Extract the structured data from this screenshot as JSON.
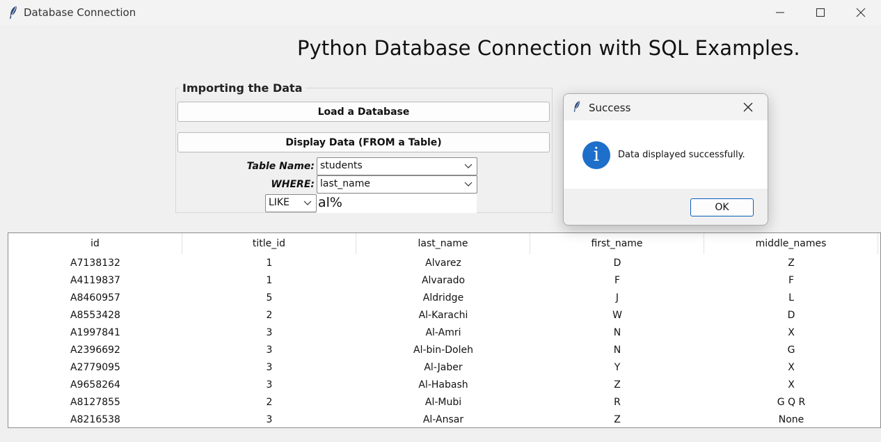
{
  "window": {
    "title": "Database Connection"
  },
  "page": {
    "heading": "Python Database Connection with SQL Examples."
  },
  "import_group": {
    "label": "Importing the Data",
    "load_button": "Load a Database",
    "display_button": "Display Data (FROM a Table)",
    "table_name_label": "Table Name:",
    "table_name_value": "students",
    "where_label": "WHERE:",
    "where_value": "last_name",
    "operator_value": "LIKE",
    "pattern_value": "al%"
  },
  "table": {
    "columns": [
      "id",
      "title_id",
      "last_name",
      "first_name",
      "middle_names"
    ],
    "rows": [
      [
        "A7138132",
        "1",
        "Alvarez",
        "D",
        "Z"
      ],
      [
        "A4119837",
        "1",
        "Alvarado",
        "F",
        "F"
      ],
      [
        "A8460957",
        "5",
        "Aldridge",
        "J",
        "L"
      ],
      [
        "A8553428",
        "2",
        "Al-Karachi",
        "W",
        "D"
      ],
      [
        "A1997841",
        "3",
        "Al-Amri",
        "N",
        "X"
      ],
      [
        "A2396692",
        "3",
        "Al-bin-Doleh",
        "N",
        "G"
      ],
      [
        "A2779095",
        "3",
        "Al-Jaber",
        "Y",
        "X"
      ],
      [
        "A9658264",
        "3",
        "Al-Habash",
        "Z",
        "X"
      ],
      [
        "A8127855",
        "2",
        "Al-Mubi",
        "R",
        "G Q R"
      ],
      [
        "A8216538",
        "3",
        "Al-Ansar",
        "Z",
        "None"
      ]
    ]
  },
  "dialog": {
    "title": "Success",
    "message": "Data displayed successfully.",
    "ok_label": "OK",
    "icon": "info-icon",
    "accent": "#1d6fc9"
  }
}
